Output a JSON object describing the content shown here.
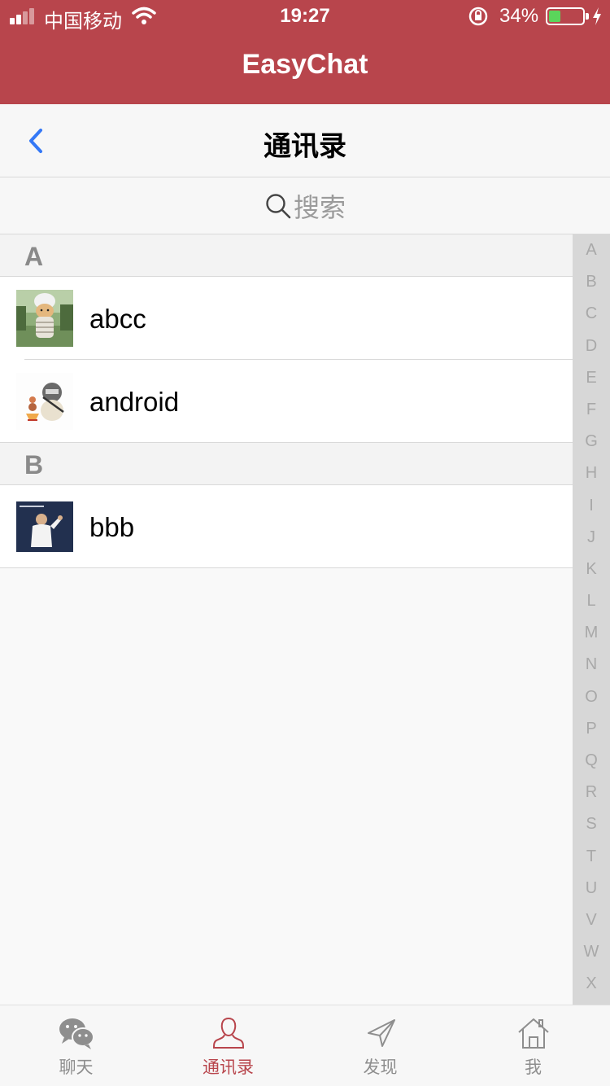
{
  "status_bar": {
    "carrier": "中国移动",
    "time": "19:27",
    "battery": "34%"
  },
  "app": {
    "title": "EasyChat"
  },
  "nav": {
    "title": "通讯录"
  },
  "search": {
    "placeholder": "搜索"
  },
  "sections": [
    {
      "letter": "A",
      "contacts": [
        "abcc",
        "android"
      ]
    },
    {
      "letter": "B",
      "contacts": [
        "bbb"
      ]
    }
  ],
  "index_letters": [
    "A",
    "B",
    "C",
    "D",
    "E",
    "F",
    "G",
    "H",
    "I",
    "J",
    "K",
    "L",
    "M",
    "N",
    "O",
    "P",
    "Q",
    "R",
    "S",
    "T",
    "U",
    "V",
    "W",
    "X"
  ],
  "tabs": [
    {
      "label": "聊天",
      "icon": "chat-bubbles-icon",
      "active": false
    },
    {
      "label": "通讯录",
      "icon": "contact-person-icon",
      "active": true
    },
    {
      "label": "发现",
      "icon": "paper-plane-icon",
      "active": false
    },
    {
      "label": "我",
      "icon": "home-icon",
      "active": false
    }
  ],
  "colors": {
    "brand": "#b8454c",
    "nav_back": "#3478f6",
    "index_bg": "#d7d7d7"
  }
}
